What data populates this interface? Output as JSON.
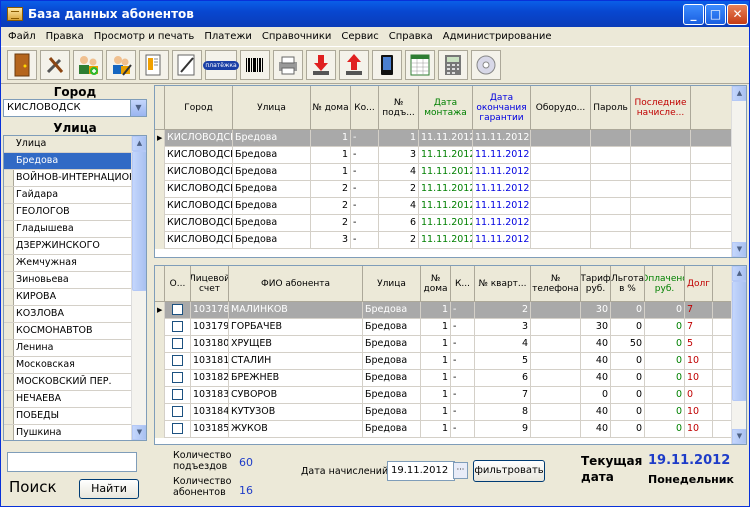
{
  "window": {
    "title": "База данных абонентов"
  },
  "menu": [
    "Файл",
    "Правка",
    "Просмотр и печать",
    "Платежи",
    "Справочники",
    "Сервис",
    "Справка",
    "Администрирование"
  ],
  "toolbar": {
    "icons": [
      "door-icon",
      "tools-icon",
      "add-user-icon",
      "edit-user-icon",
      "report-icon",
      "pen-icon",
      "platezh-icon",
      "barcode-icon",
      "printer-icon",
      "download-icon",
      "upload-icon",
      "phone-icon",
      "spreadsheet-icon",
      "calculator-icon",
      "disc-icon"
    ],
    "platezh_label": "платёжка"
  },
  "left": {
    "city_label": "Город",
    "city_value": "КИСЛОВОДСК",
    "street_label": "Улица",
    "street_header": "Улица",
    "streets": [
      "Бредова",
      "ВОЙНОВ-ИНТЕРНАЦИОН",
      "Гайдара",
      "ГЕОЛОГОВ",
      "Гладышева",
      "ДЗЕРЖИНСКОГО",
      "Жемчужная",
      "Зиновьева",
      "КИРОВА",
      "КОЗЛОВА",
      "КОСМОНАВТОВ",
      "Ленина",
      "Московская",
      "МОСКОВСКИЙ ПЕР.",
      "НЕЧАЕВА",
      "ПОБЕДЫ",
      "Пушкина"
    ],
    "selected_street_index": 0,
    "search_label": "Поиск",
    "find_button": "Найти",
    "search_value": ""
  },
  "entrances": {
    "columns": [
      "Город",
      "Улица",
      "№ дома",
      "Ко...",
      "№ подъ...",
      "Дата монтажа",
      "Дата окончания гарантии",
      "Оборудо...",
      "Пароль",
      "Последние начисле..."
    ],
    "rows": [
      [
        "КИСЛОВОДСК",
        "Бредова",
        "1",
        "-",
        "1",
        "11.11.2012",
        "11.11.2012",
        "",
        "",
        ""
      ],
      [
        "КИСЛОВОДСК",
        "Бредова",
        "1",
        "-",
        "3",
        "11.11.2012",
        "11.11.2012",
        "",
        "",
        ""
      ],
      [
        "КИСЛОВОДСК",
        "Бредова",
        "1",
        "-",
        "4",
        "11.11.2012",
        "11.11.2012",
        "",
        "",
        ""
      ],
      [
        "КИСЛОВОДСК",
        "Бредова",
        "2",
        "-",
        "2",
        "11.11.2012",
        "11.11.2012",
        "",
        "",
        ""
      ],
      [
        "КИСЛОВОДСК",
        "Бредова",
        "2",
        "-",
        "4",
        "11.11.2012",
        "11.11.2012",
        "",
        "",
        ""
      ],
      [
        "КИСЛОВОДСК",
        "Бредова",
        "2",
        "-",
        "6",
        "11.11.2012",
        "11.11.2012",
        "",
        "",
        ""
      ],
      [
        "КИСЛОВОДСК",
        "Бредова",
        "3",
        "-",
        "2",
        "11.11.2012",
        "11.11.2012",
        "",
        "",
        ""
      ]
    ]
  },
  "subscribers": {
    "columns": [
      "О...",
      "Лицевой счет",
      "ФИО абонента",
      "Улица",
      "№ дома",
      "К...",
      "№ кварт...",
      "№ телефона",
      "Тариф руб.",
      "Льгота в %",
      "Оплачено руб.",
      "Долг"
    ],
    "rows": [
      [
        "",
        "103178",
        "МАЛИНКОВ",
        "Бредова",
        "1",
        "-",
        "2",
        "",
        "30",
        "0",
        "0",
        "7"
      ],
      [
        "",
        "103179",
        "ГОРБАЧЕВ",
        "Бредова",
        "1",
        "-",
        "3",
        "",
        "30",
        "0",
        "0",
        "7"
      ],
      [
        "",
        "103180",
        "ХРУЩЕВ",
        "Бредова",
        "1",
        "-",
        "4",
        "",
        "40",
        "50",
        "0",
        "5"
      ],
      [
        "",
        "103181",
        "СТАЛИН",
        "Бредова",
        "1",
        "-",
        "5",
        "",
        "40",
        "0",
        "0",
        "10"
      ],
      [
        "",
        "103182",
        "БРЕЖНЕВ",
        "Бредова",
        "1",
        "-",
        "6",
        "",
        "40",
        "0",
        "0",
        "10"
      ],
      [
        "",
        "103183",
        "СУВОРОВ",
        "Бредова",
        "1",
        "-",
        "7",
        "",
        "0",
        "0",
        "0",
        "0"
      ],
      [
        "",
        "103184",
        "КУТУЗОВ",
        "Бредова",
        "1",
        "-",
        "8",
        "",
        "40",
        "0",
        "0",
        "10"
      ],
      [
        "",
        "103185",
        "ЖУКОВ",
        "Бредова",
        "1",
        "-",
        "9",
        "",
        "40",
        "0",
        "0",
        "10"
      ]
    ]
  },
  "bottom": {
    "entr_count_label": "Количество подъездов",
    "entr_count": "60",
    "subs_count_label": "Количество абонентов",
    "subs_count": "16",
    "charge_date_label": "Дата начислений",
    "charge_date": "19.11.2012",
    "filter_button": "фильтровать",
    "current_date_label": "Текущая дата",
    "current_date": "19.11.2012",
    "weekday": "Понедельник"
  },
  "colors": {
    "accent": "#316ac5",
    "date_green": "#008000",
    "date_blue": "#0000e0",
    "debt_red": "#c00000"
  }
}
